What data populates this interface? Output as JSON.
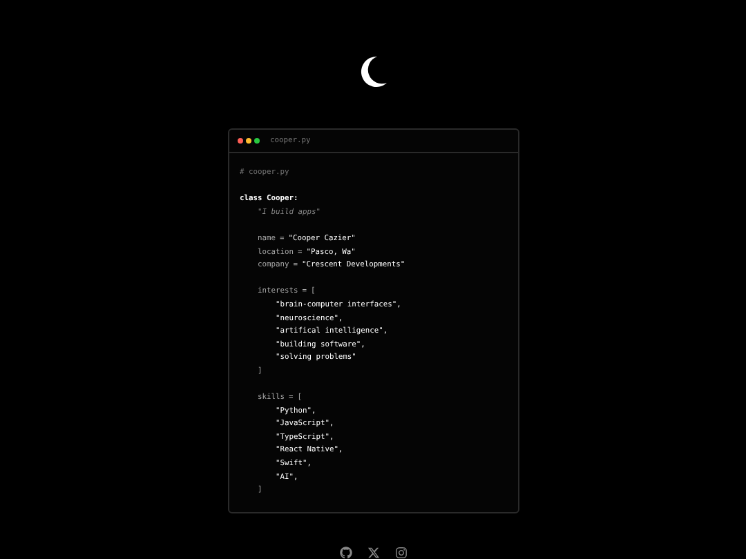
{
  "window": {
    "title": "cooper.py",
    "dots": [
      {
        "color": "#ff5f57"
      },
      {
        "color": "#febc2e"
      },
      {
        "color": "#28c840"
      }
    ]
  },
  "code": {
    "comment": "# cooper.py",
    "class_line": "class Cooper:",
    "docstring": "\"I build apps\"",
    "fields": [
      {
        "name": "name",
        "op": "=",
        "value": "\"Cooper Cazier\""
      },
      {
        "name": "location",
        "op": "=",
        "value": "\"Pasco, Wa\""
      },
      {
        "name": "company",
        "op": "=",
        "value": "\"Crescent Developments\""
      }
    ],
    "lists": [
      {
        "name": "interests",
        "op": "=",
        "open": "[",
        "close": "]",
        "items": [
          "\"brain-computer interfaces\",",
          "\"neuroscience\",",
          "\"artifical intelligence\",",
          "\"building software\",",
          "\"solving problems\""
        ]
      },
      {
        "name": "skills",
        "op": "=",
        "open": "[",
        "close": "]",
        "items": [
          "\"Python\",",
          "\"JavaScript\",",
          "\"TypeScript\",",
          "\"React Native\",",
          "\"Swift\",",
          "\"AI\","
        ]
      }
    ]
  }
}
